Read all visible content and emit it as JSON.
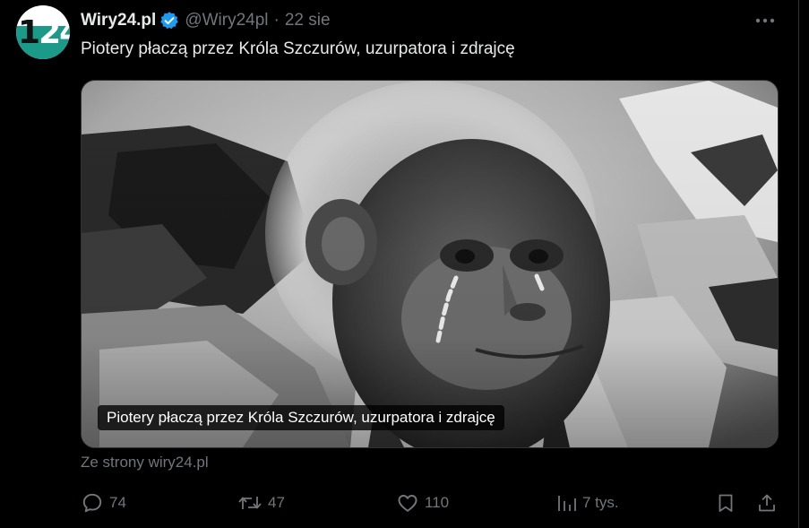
{
  "account": {
    "avatar_text": "24",
    "avatar_text_first": "1",
    "display_name": "Wiry24.pl",
    "handle": "@Wiry24pl",
    "separator": "·",
    "date": "22 sie"
  },
  "tweet": {
    "text": "Piotery płaczą przez Króla Szczurów, uzurpatora i zdrajcę",
    "media_caption": "Piotery płaczą przez Króla Szczurów, uzurpatora i zdrajcę",
    "source": "Ze strony wiry24.pl"
  },
  "actions": {
    "replies": "74",
    "reposts": "47",
    "likes": "110",
    "views": "7 tys."
  },
  "colors": {
    "background": "#000000",
    "text_primary": "#e7e9ea",
    "text_secondary": "#71767b",
    "verified": "#1d9bf0",
    "avatar_accent": "#1b9a8a",
    "border": "#2f3336"
  },
  "icons": [
    "verified-badge-icon",
    "more-icon",
    "reply-icon",
    "repost-icon",
    "like-icon",
    "views-icon",
    "bookmark-icon",
    "share-icon"
  ]
}
